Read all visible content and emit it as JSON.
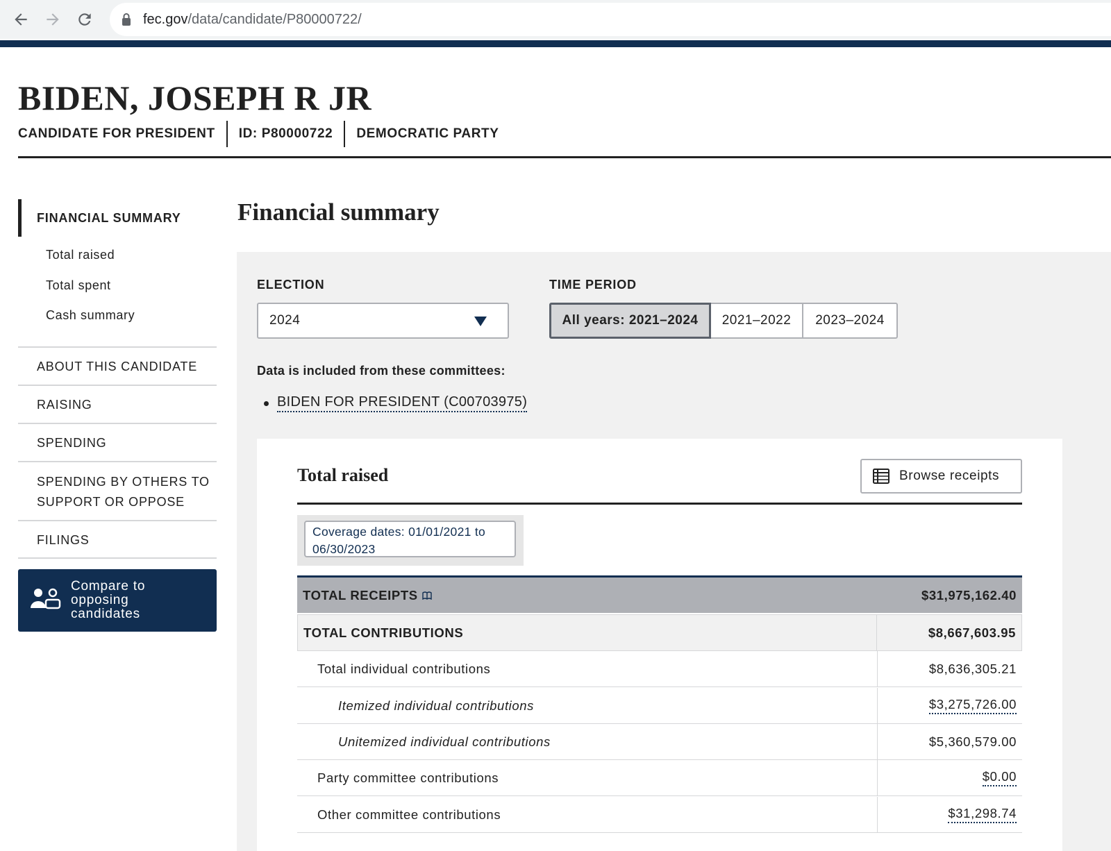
{
  "browser": {
    "url_host": "fec.gov",
    "url_path": "/data/candidate/P80000722/"
  },
  "candidate": {
    "name": "BIDEN, JOSEPH R JR",
    "office": "CANDIDATE FOR PRESIDENT",
    "id": "ID: P80000722",
    "party": "DEMOCRATIC PARTY"
  },
  "sidebar": {
    "active": "FINANCIAL SUMMARY",
    "subitems": [
      "Total raised",
      "Total spent",
      "Cash summary"
    ],
    "items": [
      "ABOUT THIS CANDIDATE",
      "RAISING",
      "SPENDING",
      "SPENDING BY OTHERS TO SUPPORT OR OPPOSE",
      "FILINGS"
    ],
    "compare_label": "Compare to opposing candidates"
  },
  "main": {
    "title": "Financial summary",
    "election_label": "ELECTION",
    "election_value": "2024",
    "time_period_label": "TIME PERIOD",
    "time_periods": [
      "All years: 2021–2024",
      "2021–2022",
      "2023–2024"
    ],
    "selected_time_period": "All years: 2021–2024",
    "committees_note": "Data is included from these committees:",
    "committees": [
      "BIDEN FOR PRESIDENT (C00703975)"
    ]
  },
  "total_raised": {
    "title": "Total raised",
    "browse_label": "Browse receipts",
    "coverage": "Coverage dates: 01/01/2021 to 06/30/2023",
    "rows": [
      {
        "label": "TOTAL RECEIPTS",
        "value": "$31,975,162.40"
      },
      {
        "label": "TOTAL CONTRIBUTIONS",
        "value": "$8,667,603.95"
      },
      {
        "label": "Total individual contributions",
        "value": "$8,636,305.21"
      },
      {
        "label": "Itemized individual contributions",
        "value": "$3,275,726.00"
      },
      {
        "label": "Unitemized individual contributions",
        "value": "$5,360,579.00"
      },
      {
        "label": "Party committee contributions",
        "value": "$0.00"
      },
      {
        "label": "Other committee contributions",
        "value": "$31,298.74"
      }
    ]
  },
  "colors": {
    "navy": "#112e51",
    "panel_gray": "#f1f1f1",
    "total_row_gray": "#aeb0b5"
  }
}
